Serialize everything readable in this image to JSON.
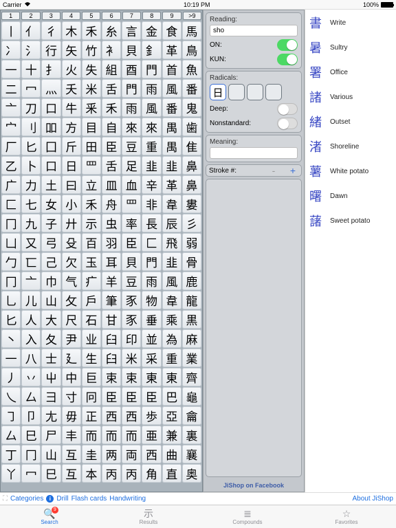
{
  "status": {
    "carrier": "Carrier",
    "time": "10:19 PM",
    "battery": "100%"
  },
  "rad_cols": [
    "1",
    "2",
    "3",
    "4",
    "5",
    "6",
    "7",
    "8",
    "9",
    ">9"
  ],
  "radicals": [
    "丨",
    "亻",
    "彳",
    "木",
    "禾",
    "糸",
    "言",
    "金",
    "食",
    "馬",
    "冫",
    "氵",
    "行",
    "矢",
    "竹",
    "衤",
    "貝",
    "釒",
    "革",
    "鳥",
    "一",
    "十",
    "扌",
    "火",
    "失",
    "組",
    "酉",
    "門",
    "首",
    "魚",
    "二",
    "冖",
    "灬",
    "夭",
    "米",
    "舌",
    "門",
    "雨",
    "風",
    "番",
    "亠",
    "刀",
    "口",
    "牛",
    "釆",
    "禾",
    "雨",
    "風",
    "番",
    "鬼",
    "宀",
    "刂",
    "吅",
    "方",
    "目",
    "自",
    "來",
    "來",
    "禺",
    "歯",
    "厂",
    "匕",
    "囗",
    "斤",
    "田",
    "臣",
    "豆",
    "重",
    "禺",
    "隹",
    "乙",
    "卜",
    "口",
    "日",
    "罒",
    "舌",
    "足",
    "韭",
    "韭",
    "鼻",
    "广",
    "力",
    "土",
    "曰",
    "立",
    "皿",
    "血",
    "辛",
    "革",
    "鼻",
    "匚",
    "七",
    "女",
    "小",
    "禾",
    "舟",
    "罒",
    "非",
    "韋",
    "婁",
    "冂",
    "九",
    "子",
    "廾",
    "示",
    "虫",
    "率",
    "長",
    "辰",
    "彡",
    "凵",
    "又",
    "弓",
    "殳",
    "百",
    "羽",
    "臣",
    "匚",
    "飛",
    "弱",
    "勹",
    "匸",
    "己",
    "欠",
    "玉",
    "耳",
    "貝",
    "門",
    "韭",
    "骨",
    "冂",
    "亠",
    "巾",
    "气",
    "疒",
    "羊",
    "豆",
    "雨",
    "風",
    "鹿",
    "乚",
    "儿",
    "山",
    "攵",
    "戶",
    "筆",
    "豕",
    "物",
    "韋",
    "龍",
    "匕",
    "人",
    "大",
    "尺",
    "石",
    "甘",
    "豕",
    "垂",
    "乘",
    "黒",
    "丶",
    "入",
    "夂",
    "尹",
    "业",
    "臼",
    "印",
    "並",
    "為",
    "麻",
    "一",
    "八",
    "士",
    "廴",
    "生",
    "臼",
    "米",
    "采",
    "重",
    "業",
    "丿",
    "丷",
    "屮",
    "中",
    "巨",
    "束",
    "束",
    "東",
    "東",
    "齊",
    "乀",
    "厶",
    "彐",
    "寸",
    "冋",
    "臣",
    "臣",
    "臣",
    "巴",
    "龜",
    "㇆",
    "卩",
    "尢",
    "毋",
    "正",
    "西",
    "西",
    "歩",
    "亞",
    "龠",
    "厶",
    "巳",
    "尸",
    "丰",
    "而",
    "而",
    "而",
    "亜",
    "兼",
    "裏",
    "丁",
    "冂",
    "山",
    "互",
    "圭",
    "两",
    "両",
    "西",
    "曲",
    "襄",
    "丫",
    "冖",
    "巳",
    "互",
    "本",
    "丙",
    "丙",
    "角",
    "直",
    "奥"
  ],
  "reading": {
    "label": "Reading:",
    "value": "sho",
    "on": "ON:",
    "kun": "KUN:"
  },
  "radbox": {
    "label": "Radicals:",
    "selected": "日",
    "deep": "Deep:",
    "nonstd": "Nonstandard:"
  },
  "meaning": {
    "label": "Meaning:",
    "value": ""
  },
  "stroke": {
    "label": "Stroke #:",
    "value": ""
  },
  "facebook": "JiShop on Facebook",
  "results": [
    {
      "k": "書",
      "m": "Write"
    },
    {
      "k": "暑",
      "m": "Sultry"
    },
    {
      "k": "署",
      "m": "Office"
    },
    {
      "k": "諸",
      "m": "Various"
    },
    {
      "k": "緒",
      "m": "Outset"
    },
    {
      "k": "渚",
      "m": "Shoreline"
    },
    {
      "k": "薯",
      "m": "White potato"
    },
    {
      "k": "曙",
      "m": "Dawn"
    },
    {
      "k": "藷",
      "m": "Sweet potato"
    }
  ],
  "links": {
    "categories": "Categories",
    "drill": "Drill",
    "flash": "Flash cards",
    "hand": "Handwriting",
    "about": "About JiShop"
  },
  "tabs": {
    "search": "Search",
    "results": "Results",
    "compounds": "Compounds",
    "favorites": "Favorites",
    "badge": "9"
  }
}
